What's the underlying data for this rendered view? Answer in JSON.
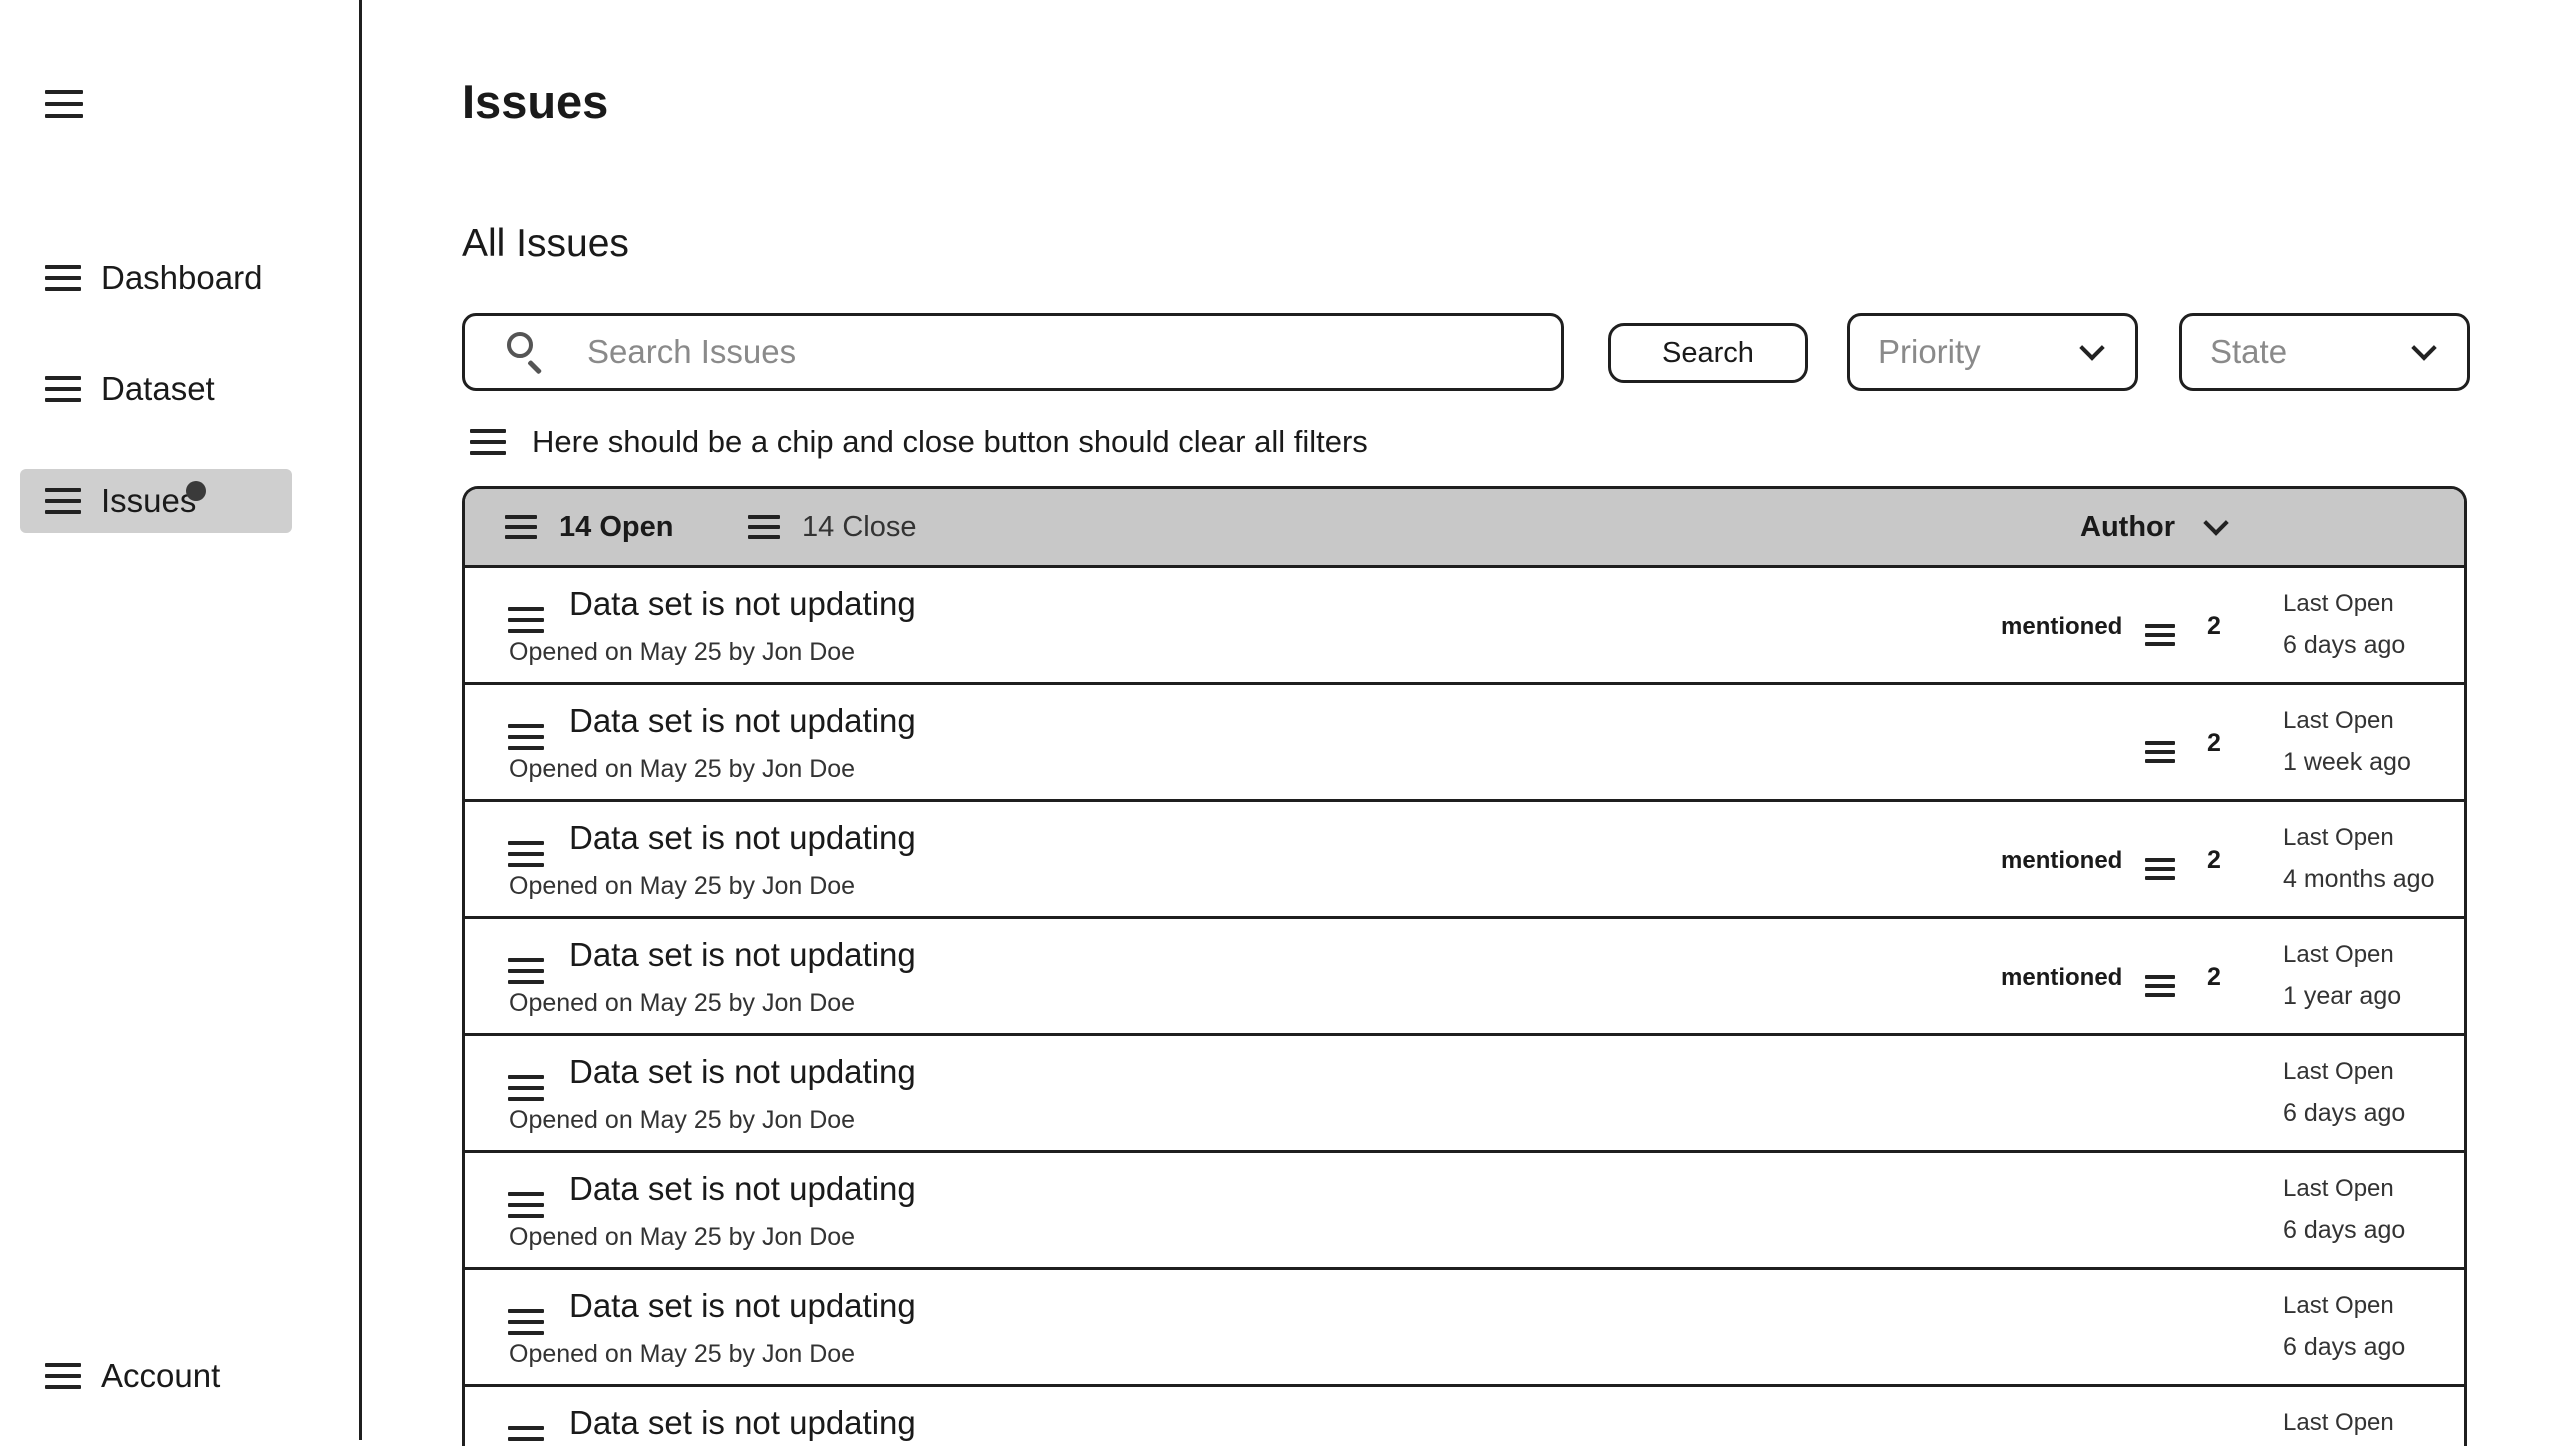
{
  "sidebar": {
    "items": [
      {
        "label": "Dashboard"
      },
      {
        "label": "Dataset"
      },
      {
        "label": "Issues"
      }
    ],
    "account_label": "Account",
    "active_item": "Issues"
  },
  "header": {
    "title": "Issues"
  },
  "main": {
    "section_title": "All Issues",
    "search": {
      "placeholder": "Search Issues",
      "value": ""
    },
    "search_button_label": "Search",
    "priority_dropdown": {
      "placeholder": "Priority"
    },
    "state_dropdown": {
      "placeholder": "State"
    },
    "filter_note": "Here should be a chip and close button should clear all filters",
    "list_header": {
      "open_tab": "14 Open",
      "closed_tab": "14 Close",
      "author_filter": "Author"
    },
    "issues": [
      {
        "title": "Data set is not updating",
        "meta": "Opened on May 25 by Jon Doe",
        "mention": "mentioned",
        "comments": "2",
        "last_label": "Last Open",
        "last_time": "6 days ago"
      },
      {
        "title": "Data set is not updating",
        "meta": "Opened on May 25 by Jon Doe",
        "mention": "",
        "comments": "2",
        "last_label": "Last Open",
        "last_time": "1 week ago"
      },
      {
        "title": "Data set is not updating",
        "meta": "Opened on May 25 by Jon Doe",
        "mention": "mentioned",
        "comments": "2",
        "last_label": "Last Open",
        "last_time": "4 months ago"
      },
      {
        "title": "Data set is not updating",
        "meta": "Opened on May 25 by Jon Doe",
        "mention": "mentioned",
        "comments": "2",
        "last_label": "Last Open",
        "last_time": "1 year ago"
      },
      {
        "title": "Data set is not updating",
        "meta": "Opened on May 25 by Jon Doe",
        "mention": "",
        "comments": "",
        "last_label": "Last Open",
        "last_time": "6 days ago"
      },
      {
        "title": "Data set is not updating",
        "meta": "Opened on May 25 by Jon Doe",
        "mention": "",
        "comments": "",
        "last_label": "Last Open",
        "last_time": "6 days ago"
      },
      {
        "title": "Data set is not updating",
        "meta": "Opened on May 25 by Jon Doe",
        "mention": "",
        "comments": "",
        "last_label": "Last Open",
        "last_time": "6 days ago"
      },
      {
        "title": "Data set is not updating",
        "meta": "",
        "mention": "",
        "comments": "",
        "last_label": "Last Open",
        "last_time": ""
      }
    ]
  },
  "colors": {
    "active_nav_bg": "#cfcfcf",
    "list_header_bg": "#c8c8c8",
    "border": "#1f1f1f",
    "placeholder_text": "#8a8a8a"
  },
  "icons": {
    "menu": "hamburger-icon",
    "search": "search-icon",
    "dropdown": "chevron-down-icon",
    "notification": "notification-dot"
  }
}
